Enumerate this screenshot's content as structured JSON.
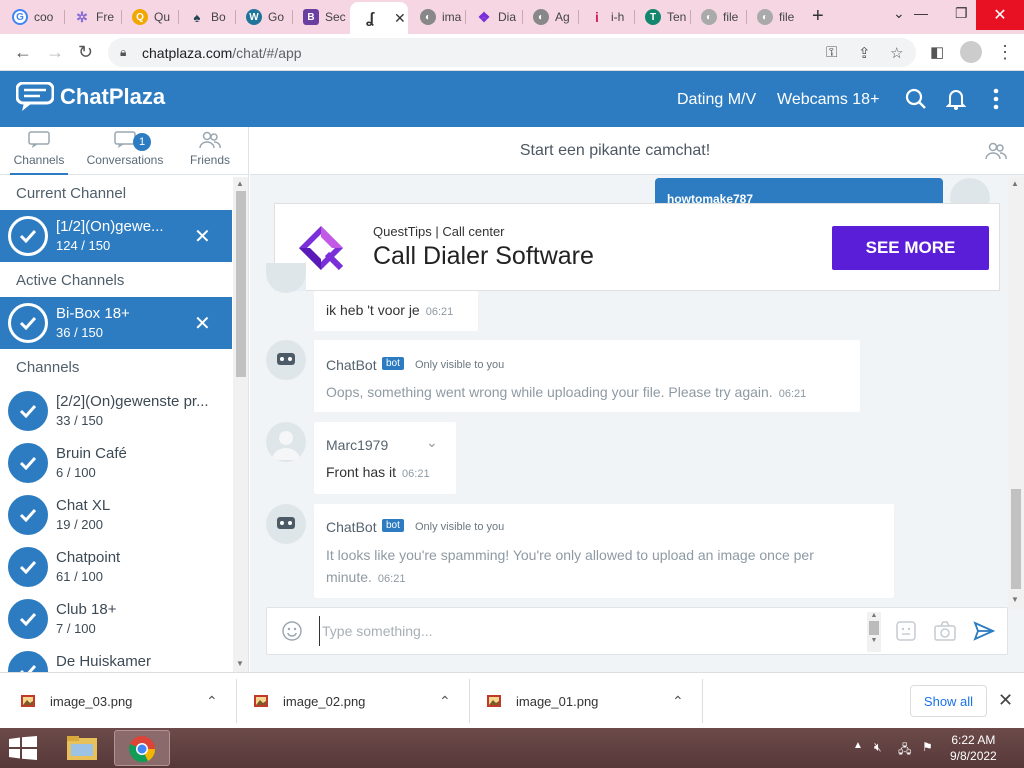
{
  "browser": {
    "tabs": [
      {
        "title": "coo",
        "icon": "google-icon",
        "color": "#4285f4"
      },
      {
        "title": "Fre",
        "icon": "star-icon",
        "color": "#8b6fd6"
      },
      {
        "title": "Qu",
        "icon": "search-icon",
        "color": "#f2a600"
      },
      {
        "title": "Bo",
        "icon": "book-icon",
        "color": "#245"
      },
      {
        "title": "Go",
        "icon": "wordpress-icon",
        "color": "#21759b"
      },
      {
        "title": "Sec",
        "icon": "b-icon",
        "color": "#6b3fa0"
      },
      {
        "title": "",
        "icon": "hook-icon",
        "color": "#333"
      },
      {
        "title": "ima",
        "icon": "globe-icon",
        "color": "#666"
      },
      {
        "title": "Dia",
        "icon": "quest-icon",
        "color": "#7b2fd8"
      },
      {
        "title": "Ag",
        "icon": "globe-icon",
        "color": "#666"
      },
      {
        "title": "i-h",
        "icon": "i-icon",
        "color": "#d0235a"
      },
      {
        "title": "Ten",
        "icon": "t-icon",
        "color": "#14866d"
      },
      {
        "title": "file",
        "icon": "globe-icon",
        "color": "#999"
      },
      {
        "title": "file",
        "icon": "globe-icon",
        "color": "#999"
      }
    ],
    "new_tab": "+",
    "url_domain": "chatplaza.com",
    "url_path": "/chat/#/app"
  },
  "header": {
    "logo": "ChatPlaza",
    "links": [
      "Dating M/V",
      "Webcams 18+"
    ]
  },
  "sidebar": {
    "tabs": [
      "Channels",
      "Conversations",
      "Friends"
    ],
    "conversations_badge": "1",
    "current_heading": "Current Channel",
    "current": {
      "name": "[1/2](On)gewe...",
      "count": "124 / 150"
    },
    "active_heading": "Active Channels",
    "active": {
      "name": "Bi-Box 18+",
      "count": "36 / 150"
    },
    "channels_heading": "Channels",
    "channels": [
      {
        "name": "[2/2](On)gewenste pr...",
        "count": "33 / 150"
      },
      {
        "name": "Bruin Café",
        "count": "6 / 100"
      },
      {
        "name": "Chat XL",
        "count": "19 / 200"
      },
      {
        "name": "Chatpoint",
        "count": "61 / 100"
      },
      {
        "name": "Club 18+",
        "count": "7 / 100"
      },
      {
        "name": "De Huiskamer",
        "count": ""
      }
    ]
  },
  "main": {
    "title": "Start een pikante camchat!",
    "user_bubble": "howtomake787",
    "ad": {
      "brand": "QuestTips | Call center",
      "title": "Call Dialer Software",
      "button": "SEE MORE",
      "choice": "✕ ▷"
    },
    "messages": [
      {
        "text": "ik heb 't voor je",
        "time": "06:21"
      },
      {
        "sender": "ChatBot",
        "badge": "bot",
        "note": "Only visible to you",
        "text": "Oops, something went wrong while uploading your file. Please try again.",
        "time": "06:21"
      },
      {
        "sender": "Marc1979",
        "text": "Front has it",
        "time": "06:21"
      },
      {
        "sender": "ChatBot",
        "badge": "bot",
        "note": "Only visible to you",
        "text": "It looks like you're spamming! You're only allowed to upload an image once per minute.",
        "time": "06:21"
      }
    ],
    "composer_placeholder": "Type something..."
  },
  "downloads": {
    "files": [
      "image_03.png",
      "image_02.png",
      "image_01.png"
    ],
    "show_all": "Show all"
  },
  "taskbar": {
    "time": "6:22 AM",
    "date": "9/8/2022"
  },
  "colors": {
    "brand": "#2d7cc1",
    "ad_button": "#5b1ed8",
    "tab_strip": "#f6d6e2",
    "taskbar": "#5f4040"
  }
}
